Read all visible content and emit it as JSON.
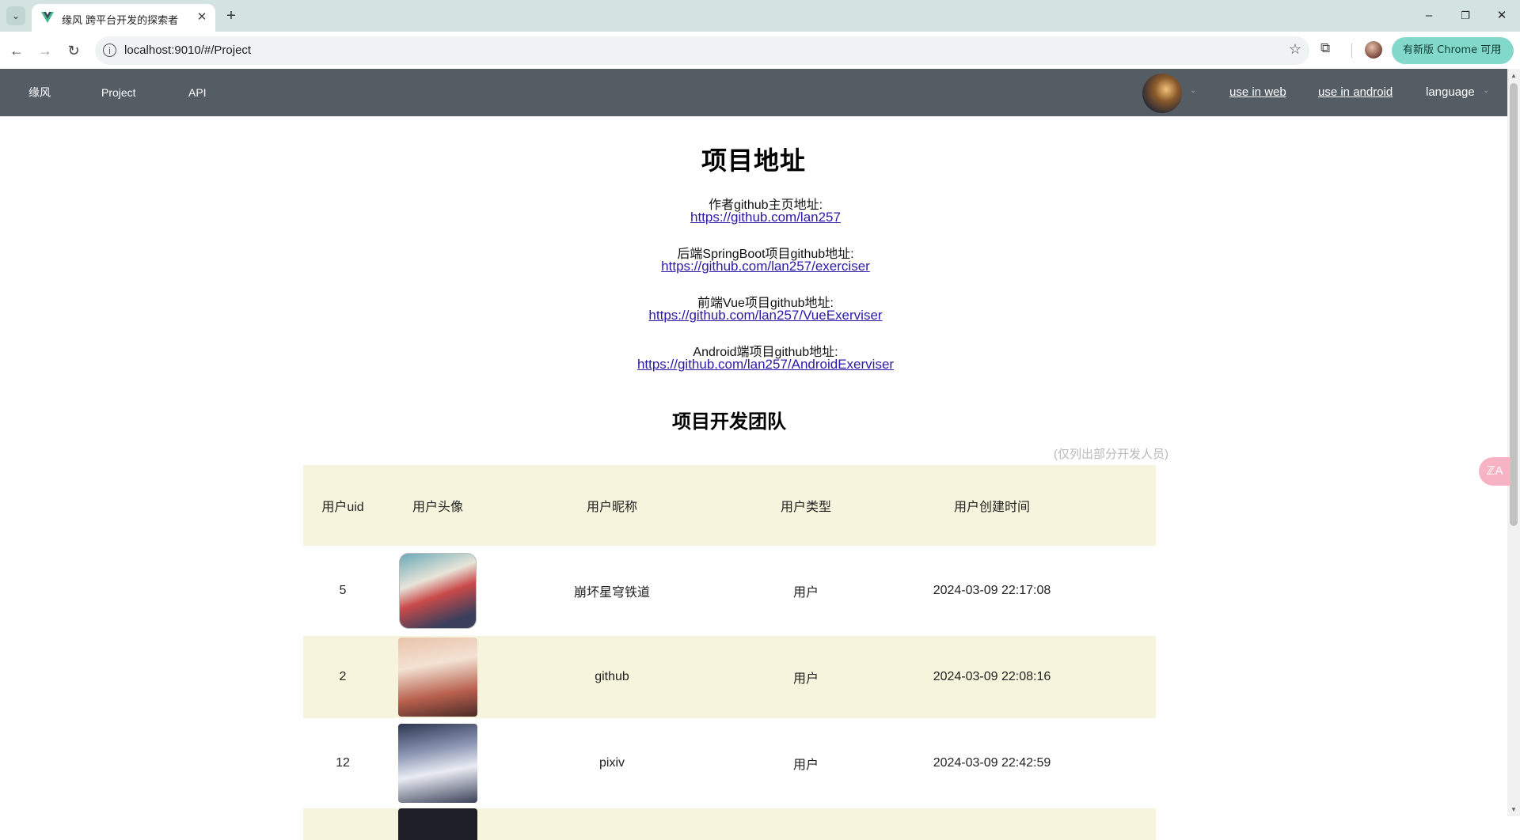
{
  "browser": {
    "tab_title": "缘风 跨平台开发的探索者",
    "url": "localhost:9010/#/Project",
    "update_chip": "有新版 Chrome 可用",
    "icons": {
      "tab_list": "chevron-down-icon",
      "favicon": "vue-logo-icon",
      "close": "close-icon",
      "new_tab": "plus-icon",
      "back": "arrow-left-icon",
      "forward": "arrow-right-icon",
      "reload": "reload-icon",
      "site_info": "info-icon",
      "bookmark": "star-icon",
      "extensions": "puzzle-icon",
      "menu": "more-vertical-icon"
    },
    "glyphs": {
      "tab_list": "⌄",
      "close": "✕",
      "new_tab": "+",
      "back": "←",
      "forward": "→",
      "reload": "↻",
      "site_info": "i",
      "bookmark": "☆",
      "extensions": "⧉",
      "minimize": "–",
      "restore": "❐",
      "window_close": "✕",
      "menu": "⋮"
    }
  },
  "nav": {
    "brand": "缘风",
    "items": [
      "Project",
      "API"
    ],
    "links": [
      "use in web",
      "use in android"
    ],
    "language": "language",
    "caret": "⌄",
    "colors": {
      "background": "#545c64",
      "text": "#ffffff"
    }
  },
  "page": {
    "title": "项目地址",
    "sections": [
      {
        "label": "作者github主页地址:",
        "url": "https://github.com/lan257"
      },
      {
        "label": "后端SpringBoot项目github地址:",
        "url": "https://github.com/lan257/exerciser"
      },
      {
        "label": "前端Vue项目github地址:",
        "url": "https://github.com/lan257/VueExerviser"
      },
      {
        "label": "Android端项目github地址:",
        "url": "https://github.com/lan257/AndroidExerviser"
      }
    ],
    "team_title": "项目开发团队",
    "team_note": "(仅列出部分开发人员)",
    "floating_button": "ℤA"
  },
  "table": {
    "columns": [
      "用户uid",
      "用户头像",
      "用户昵称",
      "用户类型",
      "用户创建时间"
    ],
    "rows": [
      {
        "uid": "5",
        "nickname": "崩坏星穹铁道",
        "type": "用户",
        "created": "2024-03-09 22:17:08"
      },
      {
        "uid": "2",
        "nickname": "github",
        "type": "用户",
        "created": "2024-03-09 22:08:16"
      },
      {
        "uid": "12",
        "nickname": "pixiv",
        "type": "用户",
        "created": "2024-03-09 22:42:59"
      }
    ],
    "colors": {
      "striped_row": "#f6f4dc",
      "link": "#2a1aa8"
    }
  }
}
